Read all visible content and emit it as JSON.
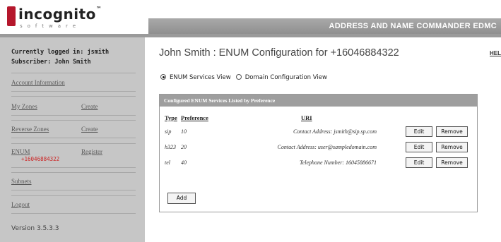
{
  "header": {
    "logo_word": "incognito",
    "logo_sub": "software",
    "title": "ADDRESS AND NAME COMMANDER EDMC"
  },
  "sidebar": {
    "logged_in": "Currently logged in: jsmith",
    "subscriber": "Subscriber: John Smith",
    "account_information": "Account Information",
    "my_zones": "My Zones",
    "my_zones_create": "Create",
    "reverse_zones": "Reverse Zones",
    "reverse_zones_create": "Create",
    "enum": "ENUM",
    "enum_register": "Register",
    "enum_number": "+16046884322",
    "subnets": "Subnets",
    "logout": "Logout",
    "version": "Version 3.5.3.3"
  },
  "main": {
    "title": "John Smith : ENUM Configuration for +16046884322",
    "help": "HEL",
    "view_options": [
      {
        "label": "ENUM Services View",
        "selected": true
      },
      {
        "label": "Domain Configuration View",
        "selected": false
      }
    ],
    "panel_title": "Configured ENUM Services Listed by Preference",
    "columns": {
      "type": "Type",
      "preference": "Preference",
      "uri": "URI"
    },
    "rows": [
      {
        "type": "sip",
        "preference": "10",
        "uri": "Contact Address:  jsmith@sip.sp.com"
      },
      {
        "type": "h323",
        "preference": "20",
        "uri": "Contact Address:  user@sampledomain.com"
      },
      {
        "type": "tel",
        "preference": "40",
        "uri": "Telephone Number:  16045886671"
      }
    ],
    "edit_label": "Edit",
    "remove_label": "Remove",
    "add_label": "Add"
  }
}
